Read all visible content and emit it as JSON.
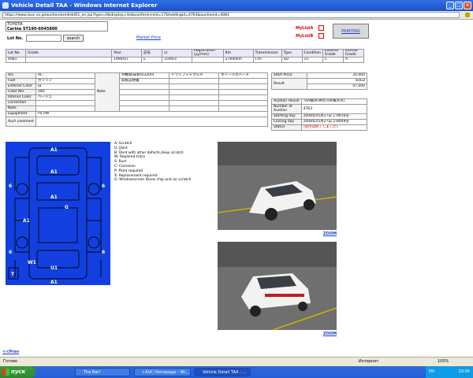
{
  "window": {
    "title": "Vehicle Detail TAA - Windows Internet Explorer"
  },
  "address": {
    "url": "https://www.iauc.co.jp/auction/prediskt01_en.jsp?type=0&display=list&conferenceid=17&holdingid=4763&auctionid=4081"
  },
  "header": {
    "make": "TOYOTA",
    "model": "Carina  ST190-6045800",
    "lot_label": "Lot No.",
    "search_label": "search",
    "market_price": "Market Price",
    "mylist_a": "MyListA",
    "mylist_b": "MyListB",
    "printing": "PRINTING"
  },
  "lot_table": {
    "headers": [
      "Lot No.",
      "Grade",
      "Year",
      "記号",
      "cc",
      "Registration (yy/mm)",
      "Km",
      "Transmission",
      "Type",
      "Condition",
      "Exterior Grade",
      "Interior Grade"
    ],
    "values": [
      "4081",
      "",
      "1994/ST",
      "E",
      "1500cc",
      "",
      "27000km",
      "F.AT",
      "4D",
      "15",
      "C",
      "A"
    ]
  },
  "spec_table": {
    "rows": [
      {
        "label": "A/C",
        "value": "AC"
      },
      {
        "label": "Fuel",
        "value": "ガソリン"
      },
      {
        "label": "Exterior Color",
        "value": "白"
      },
      {
        "label": "Color NO.",
        "value": "040"
      },
      {
        "label": "Interior Color",
        "value": "ベージュ"
      },
      {
        "label": "Correction",
        "value": ""
      },
      {
        "label": "Note",
        "value": ""
      },
      {
        "label": "Equipment",
        "value": "PS PW"
      },
      {
        "label": "Auct comment",
        "value": ""
      }
    ],
    "note_label": "Note",
    "note_text1": "ドライブシャクルメ",
    "note_text2": "ホイールカバーメ",
    "note_text3": "※機関(床移)6320円",
    "note_text4": "取扱説明書"
  },
  "price_table": {
    "start_label": "Start Price",
    "start_value": "20,000",
    "result_label": "Result",
    "result_value1": "SOLD",
    "result_value2": "47,000"
  },
  "auction_table": {
    "rows": [
      {
        "label": "Auction House",
        "value": "TAA横浜(神奈川県横浜市)"
      },
      {
        "label": "Number of Auction",
        "value": "4763"
      },
      {
        "label": "Starting day",
        "value": "2008年05月27日 17時10分"
      },
      {
        "label": "Closing day",
        "value": "2008年05月27日 15時49分"
      },
      {
        "label": "Status",
        "value": "(受付は終了しました)"
      }
    ]
  },
  "legend": {
    "lines": [
      "A: Scratch",
      "U: Dent",
      "B: Dent with other defects,deep scratch",
      "W: Repaired trace",
      "S: Rust",
      "C: Corrosion",
      "P: Paint required",
      "X: Replacement required",
      "G: Windowscreen Stone chip and /or scratch"
    ]
  },
  "diagram": {
    "marks": [
      "A1",
      "A1",
      "A1",
      "G",
      "A1",
      "W1",
      "U1",
      "A1",
      "6",
      "6",
      "6",
      "6",
      "T"
    ],
    "fill_color": "#1240e0"
  },
  "photos": {
    "zoom1": "ZOOM",
    "zoom2": "ZOOM"
  },
  "footer": {
    "prev": "<<Prev"
  },
  "status": {
    "left": "Готово",
    "zone": "Интернет",
    "zoom": "100%"
  },
  "taskbar": {
    "start": "пуск",
    "tasks": [
      "The Bat!",
      "i-AUC Homepage - Wi...",
      "Vehicle Detail TAA - ..."
    ],
    "clock": "23:05",
    "lang": "EN"
  }
}
